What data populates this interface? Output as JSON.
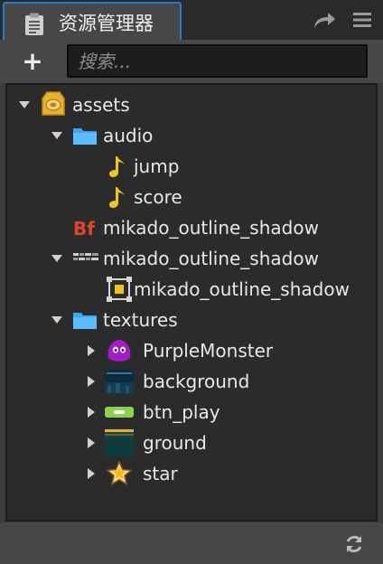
{
  "panel": {
    "tab_title": "资源管理器",
    "search_placeholder": "搜索...",
    "add_label": "+"
  },
  "tree": [
    {
      "label": "assets",
      "icon": "database-icon",
      "expanded": true,
      "depth": 0
    },
    {
      "label": "audio",
      "icon": "folder-icon",
      "expanded": true,
      "depth": 1
    },
    {
      "label": "jump",
      "icon": "audio-note-icon",
      "depth": 2
    },
    {
      "label": "score",
      "icon": "audio-note-icon",
      "depth": 2
    },
    {
      "label": "mikado_outline_shadow",
      "icon": "bitmap-font-icon",
      "depth": 1
    },
    {
      "label": "mikado_outline_shadow",
      "icon": "texture-thumbnail-icon",
      "expanded": true,
      "depth": 1
    },
    {
      "label": "mikado_outline_shadow",
      "icon": "sprite-frame-icon",
      "depth": 2
    },
    {
      "label": "textures",
      "icon": "folder-icon",
      "expanded": true,
      "depth": 1
    },
    {
      "label": "PurpleMonster",
      "icon": "purple-monster-icon",
      "expanded": false,
      "depth": 2
    },
    {
      "label": "background",
      "icon": "background-thumbnail-icon",
      "expanded": false,
      "depth": 2
    },
    {
      "label": "btn_play",
      "icon": "button-thumbnail-icon",
      "expanded": false,
      "depth": 2
    },
    {
      "label": "ground",
      "icon": "ground-thumbnail-icon",
      "expanded": false,
      "depth": 2
    },
    {
      "label": "star",
      "icon": "star-icon",
      "expanded": false,
      "depth": 2
    }
  ],
  "colors": {
    "accent": "#1f7fce",
    "folder": "#3aa7f0",
    "asset_gold": "#e8b22a",
    "bf_red": "#e0452b"
  }
}
